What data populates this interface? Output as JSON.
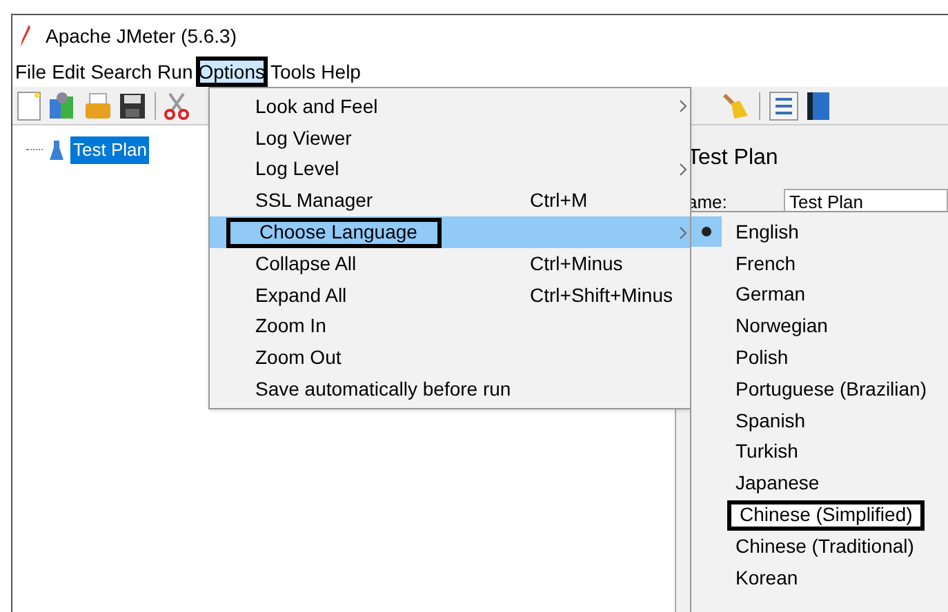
{
  "window": {
    "title": "Apache JMeter (5.6.3)"
  },
  "menu_bar": [
    {
      "label": "File",
      "open": false,
      "highlighted": false
    },
    {
      "label": "Edit",
      "open": false,
      "highlighted": false
    },
    {
      "label": "Search",
      "open": false,
      "highlighted": false
    },
    {
      "label": "Run",
      "open": false,
      "highlighted": false
    },
    {
      "label": "Options",
      "open": true,
      "highlighted": true
    },
    {
      "label": "Tools",
      "open": false,
      "highlighted": false
    },
    {
      "label": "Help",
      "open": false,
      "highlighted": false
    }
  ],
  "tree": {
    "items": [
      {
        "label": "Test Plan",
        "selected": true
      }
    ]
  },
  "panel": {
    "title": "Test Plan",
    "name_label": "ame:",
    "name_value": "Test Plan"
  },
  "options_menu": [
    {
      "label": "Look and Feel",
      "submenu": true,
      "selected": false,
      "highlighted": false
    },
    {
      "label": "Log Viewer",
      "submenu": false,
      "selected": false,
      "highlighted": false
    },
    {
      "label": "Log Level",
      "submenu": true,
      "selected": false,
      "highlighted": false
    },
    {
      "label": "SSL Manager",
      "shortcut": "Ctrl+M",
      "submenu": false,
      "selected": false,
      "highlighted": false
    },
    {
      "label": "Choose Language",
      "submenu": true,
      "selected": true,
      "highlighted": true
    },
    {
      "label": "Collapse All",
      "shortcut": "Ctrl+Minus",
      "submenu": false,
      "selected": false,
      "highlighted": false
    },
    {
      "label": "Expand All",
      "shortcut": "Ctrl+Shift+Minus",
      "submenu": false,
      "selected": false,
      "highlighted": false
    },
    {
      "label": "Zoom In",
      "submenu": false,
      "selected": false,
      "highlighted": false
    },
    {
      "label": "Zoom Out",
      "submenu": false,
      "selected": false,
      "highlighted": false
    },
    {
      "label": "Save automatically before run",
      "submenu": false,
      "selected": false,
      "highlighted": false
    }
  ],
  "language_menu": [
    {
      "label": "English",
      "selected": true,
      "highlighted": false
    },
    {
      "label": "French",
      "selected": false,
      "highlighted": false
    },
    {
      "label": "German",
      "selected": false,
      "highlighted": false
    },
    {
      "label": "Norwegian",
      "selected": false,
      "highlighted": false
    },
    {
      "label": "Polish",
      "selected": false,
      "highlighted": false
    },
    {
      "label": "Portuguese (Brazilian)",
      "selected": false,
      "highlighted": false
    },
    {
      "label": "Spanish",
      "selected": false,
      "highlighted": false
    },
    {
      "label": "Turkish",
      "selected": false,
      "highlighted": false
    },
    {
      "label": "Japanese",
      "selected": false,
      "highlighted": false
    },
    {
      "label": "Chinese (Simplified)",
      "selected": false,
      "highlighted": true
    },
    {
      "label": "Chinese (Traditional)",
      "selected": false,
      "highlighted": false
    },
    {
      "label": "Korean",
      "selected": false,
      "highlighted": false
    }
  ]
}
